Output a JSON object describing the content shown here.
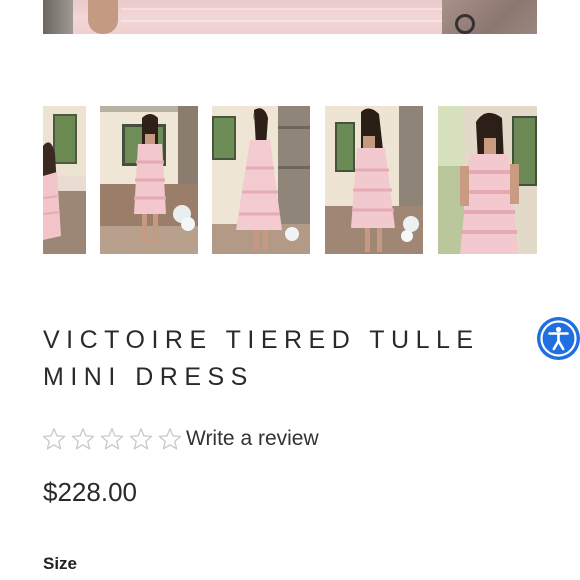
{
  "product": {
    "title": "VICTOIRE TIERED TULLE MINI DRESS",
    "price": "$228.00",
    "rating": 0,
    "rating_max": 5,
    "review_link": "Write a review",
    "size_label": "Size"
  },
  "gallery": {
    "main_image": "pink tiered tulle dress",
    "thumbnails": [
      {
        "alt": "model in pink tiered dress, cropped"
      },
      {
        "alt": "model in pink tiered dress by stone wall"
      },
      {
        "alt": "model in pink tiered dress, side view"
      },
      {
        "alt": "model in pink tiered dress, back view"
      },
      {
        "alt": "model in pink strapless tiered dress"
      }
    ]
  },
  "accessibility": {
    "icon": "accessibility-icon",
    "color": "#1f6fe0"
  },
  "colors": {
    "star_outline": "#c8c8c8",
    "text": "#2a2a2a",
    "dress_pink": "#f2cbcf"
  }
}
